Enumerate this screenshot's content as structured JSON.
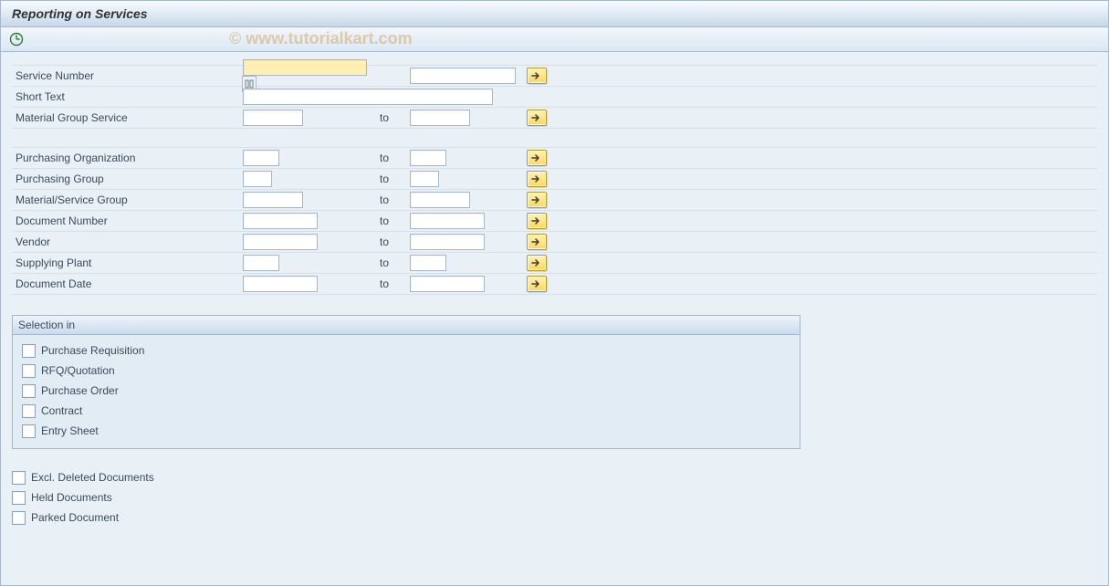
{
  "header": {
    "title": "Reporting on Services",
    "watermark": "© www.tutorialkart.com"
  },
  "toolbar": {
    "execute_icon": "execute"
  },
  "labels": {
    "to": "to",
    "service_number": "Service Number",
    "short_text": "Short Text",
    "material_group_service": "Material Group Service",
    "purchasing_org": "Purchasing Organization",
    "purchasing_group": "Purchasing Group",
    "material_service_group": "Material/Service Group",
    "document_number": "Document Number",
    "vendor": "Vendor",
    "supplying_plant": "Supplying Plant",
    "document_date": "Document Date"
  },
  "selection_group": {
    "title": "Selection in",
    "items": [
      "Purchase Requisition",
      "RFQ/Quotation",
      "Purchase Order",
      "Contract",
      "Entry Sheet"
    ]
  },
  "extra_checks": [
    "Excl. Deleted Documents",
    "Held Documents",
    "Parked Document"
  ],
  "values": {
    "service_number_from": "",
    "service_number_to": "",
    "short_text": "",
    "material_group_service_from": "",
    "material_group_service_to": "",
    "purchasing_org_from": "",
    "purchasing_org_to": "",
    "purchasing_group_from": "",
    "purchasing_group_to": "",
    "material_service_group_from": "",
    "material_service_group_to": "",
    "document_number_from": "",
    "document_number_to": "",
    "vendor_from": "",
    "vendor_to": "",
    "supplying_plant_from": "",
    "supplying_plant_to": "",
    "document_date_from": "",
    "document_date_to": ""
  }
}
